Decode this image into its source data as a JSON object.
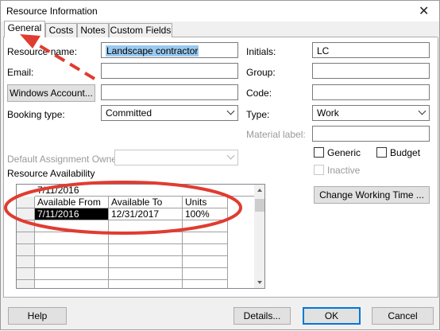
{
  "window": {
    "title": "Resource Information",
    "close_glyph": "✕"
  },
  "tabs": [
    {
      "label": "General",
      "active": true
    },
    {
      "label": "Costs",
      "active": false
    },
    {
      "label": "Notes",
      "active": false
    },
    {
      "label": "Custom Fields",
      "active": false
    }
  ],
  "form": {
    "resource_name_label": "Resource name:",
    "resource_name_value": "Landscape contractor",
    "email_label": "Email:",
    "email_value": "",
    "windows_account_button": "Windows Account...",
    "windows_account_value": "",
    "booking_type_label": "Booking type:",
    "booking_type_value": "Committed",
    "default_owner_label": "Default Assignment Owner:",
    "default_owner_value": "",
    "initials_label": "Initials:",
    "initials_value": "LC",
    "group_label": "Group:",
    "group_value": "",
    "code_label": "Code:",
    "code_value": "",
    "type_label": "Type:",
    "type_value": "Work",
    "material_label_label": "Material label:",
    "material_label_value": "",
    "generic_label": "Generic",
    "budget_label": "Budget",
    "inactive_label": "Inactive",
    "change_working_time_button": "Change Working Time ..."
  },
  "availability": {
    "section_label": "Resource Availability",
    "edit_value": "7/11/2016",
    "columns": [
      "Available From",
      "Available To",
      "Units"
    ],
    "rows": [
      {
        "from": "7/11/2016",
        "to": "12/31/2017",
        "units": "100%"
      }
    ]
  },
  "footer": {
    "help_button": "Help",
    "details_button": "Details...",
    "ok_button": "OK",
    "cancel_button": "Cancel"
  },
  "annotation": {
    "color": "#e03c31"
  }
}
